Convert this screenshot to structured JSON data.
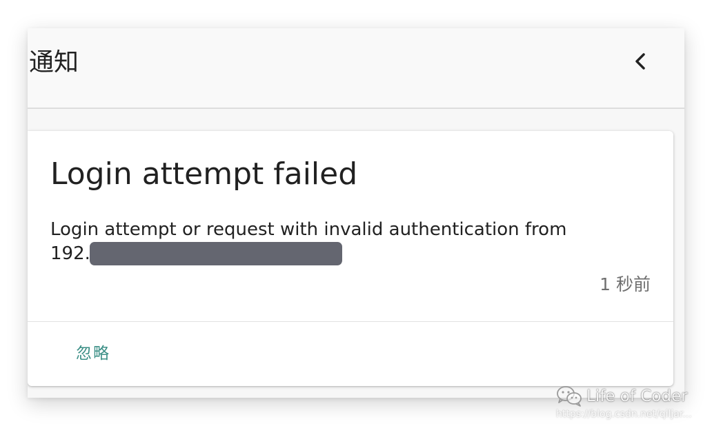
{
  "header": {
    "title": "通知",
    "back_icon": "chevron-left-icon"
  },
  "notification": {
    "title": "Login attempt failed",
    "message": "Login attempt or request with invalid authentication from",
    "ip_prefix": "192.",
    "time": "1 秒前",
    "dismiss_label": "忽略"
  },
  "watermark": {
    "brand": "Life of Coder",
    "url": "https://blog.csdn.net/qiljar...",
    "icon": "wechat-icon"
  },
  "colors": {
    "accent": "#3b8f86",
    "redaction": "#646670",
    "text": "#212121",
    "muted": "#6f6f6f"
  }
}
